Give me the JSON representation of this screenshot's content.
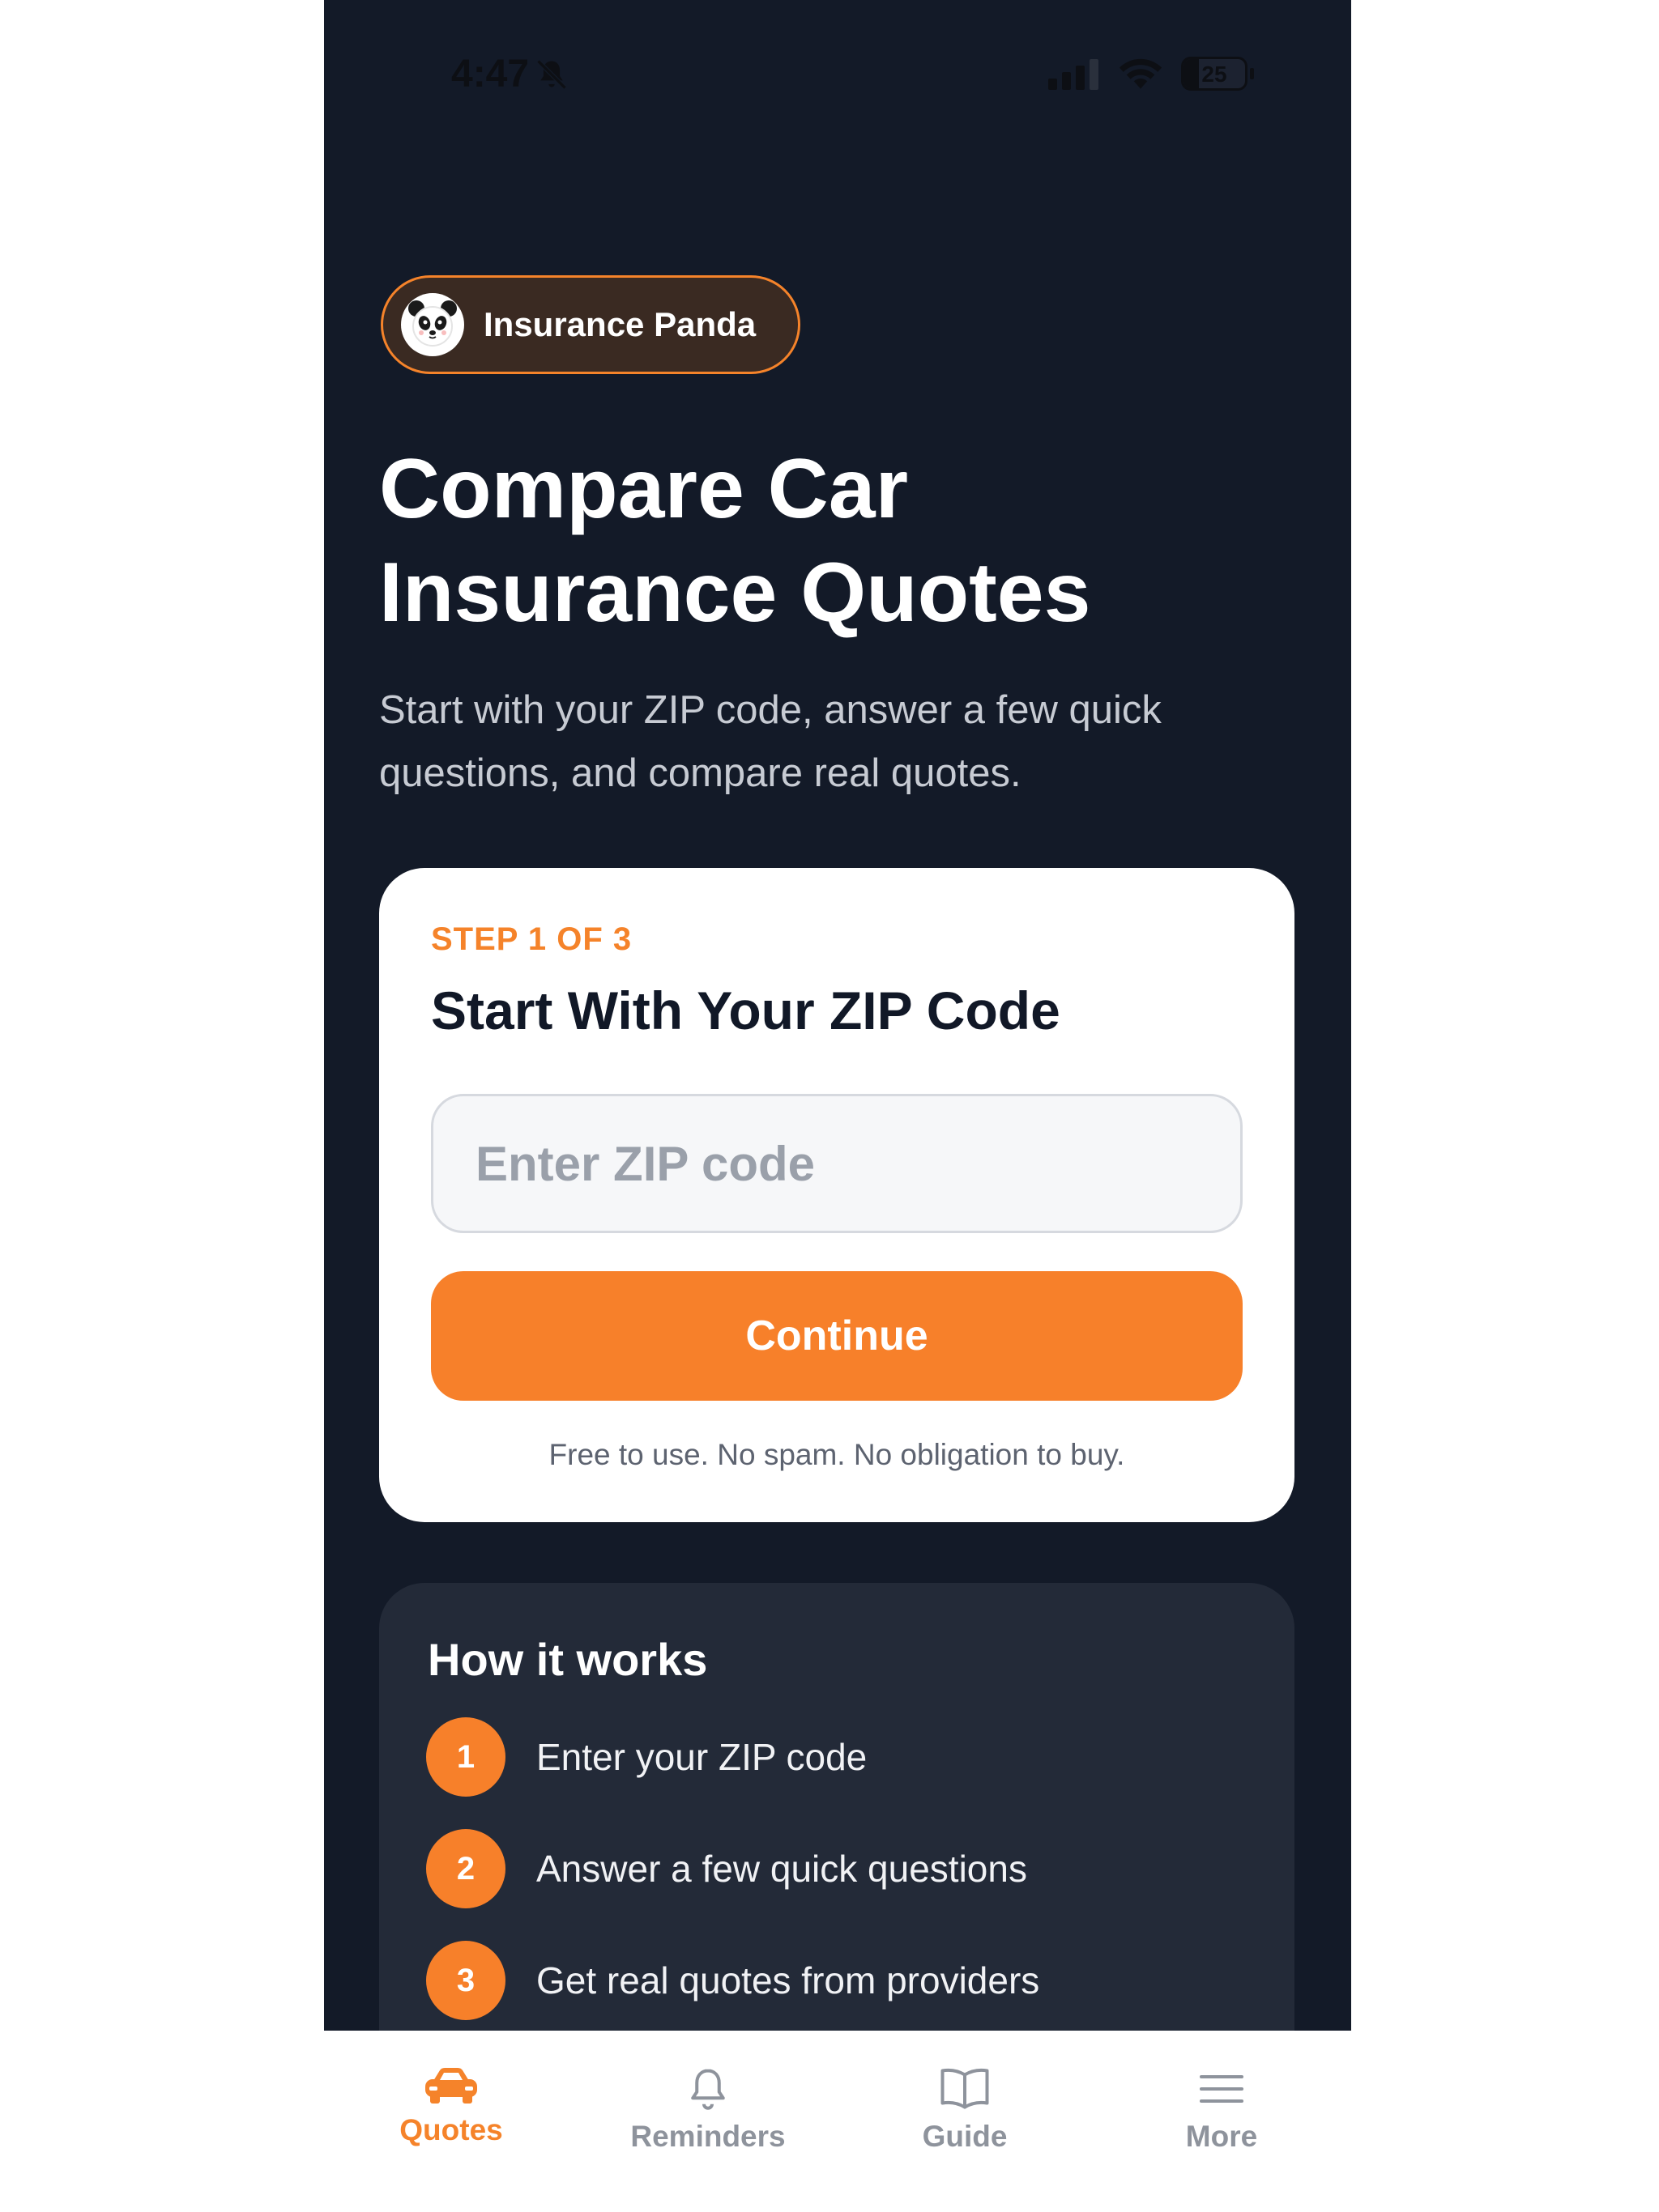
{
  "status_bar": {
    "time": "4:47",
    "battery": "25"
  },
  "brand": {
    "name": "Insurance Panda"
  },
  "hero": {
    "title": "Compare Car Insurance Quotes",
    "subtitle": "Start with your ZIP code, answer a few quick questions, and compare real quotes."
  },
  "step_card": {
    "step_label": "STEP 1 OF 3",
    "title": "Start With Your ZIP Code",
    "zip_placeholder": "Enter ZIP code",
    "zip_value": "",
    "continue_label": "Continue",
    "fine_print": "Free to use. No spam. No obligation to buy."
  },
  "how_it_works": {
    "title": "How it works",
    "steps": [
      {
        "number": "1",
        "text": "Enter your ZIP code"
      },
      {
        "number": "2",
        "text": "Answer a few quick questions"
      },
      {
        "number": "3",
        "text": "Get real quotes from providers"
      }
    ]
  },
  "tab_bar": {
    "tabs": [
      {
        "label": "Quotes",
        "icon": "car-icon",
        "active": true
      },
      {
        "label": "Reminders",
        "icon": "bell-icon",
        "active": false
      },
      {
        "label": "Guide",
        "icon": "book-icon",
        "active": false
      },
      {
        "label": "More",
        "icon": "menu-icon",
        "active": false
      }
    ]
  },
  "colors": {
    "accent": "#f5832a",
    "background": "#131a28",
    "card": "#ffffff",
    "how_card": "#232a38"
  }
}
